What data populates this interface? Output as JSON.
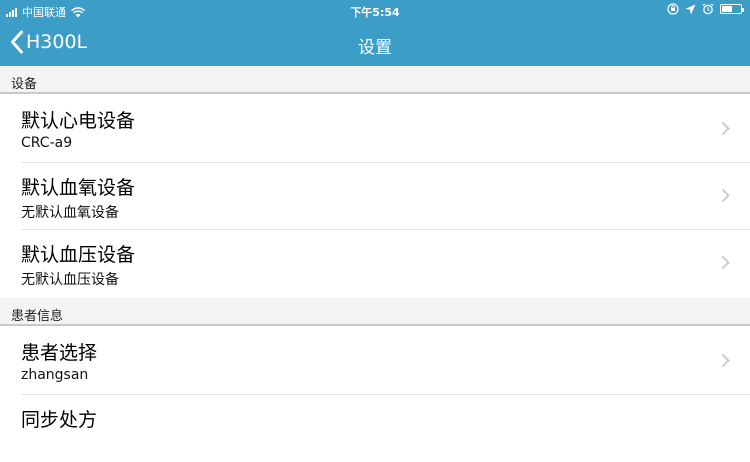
{
  "status_bar": {
    "carrier": "中国联通",
    "time": "下午5:54",
    "battery_level": 0.55,
    "icons": [
      "signal-icon",
      "wifi-icon",
      "orientation-lock-icon",
      "location-icon",
      "alarm-icon",
      "battery-icon"
    ]
  },
  "nav": {
    "back_label": "H300L",
    "title": "设置"
  },
  "sections": [
    {
      "header": "设备",
      "items": [
        {
          "title": "默认心电设备",
          "subtitle": "CRC-a9"
        },
        {
          "title": "默认血氧设备",
          "subtitle": "无默认血氧设备"
        },
        {
          "title": "默认血压设备",
          "subtitle": "无默认血压设备"
        }
      ]
    },
    {
      "header": "患者信息",
      "items": [
        {
          "title": "患者选择",
          "subtitle": "zhangsan"
        },
        {
          "title": "同步处方",
          "subtitle": ""
        }
      ]
    }
  ],
  "colors": {
    "accent": "#3c9ec7",
    "section_bg": "#f4f4f4",
    "chevron": "#c7c7cc"
  }
}
